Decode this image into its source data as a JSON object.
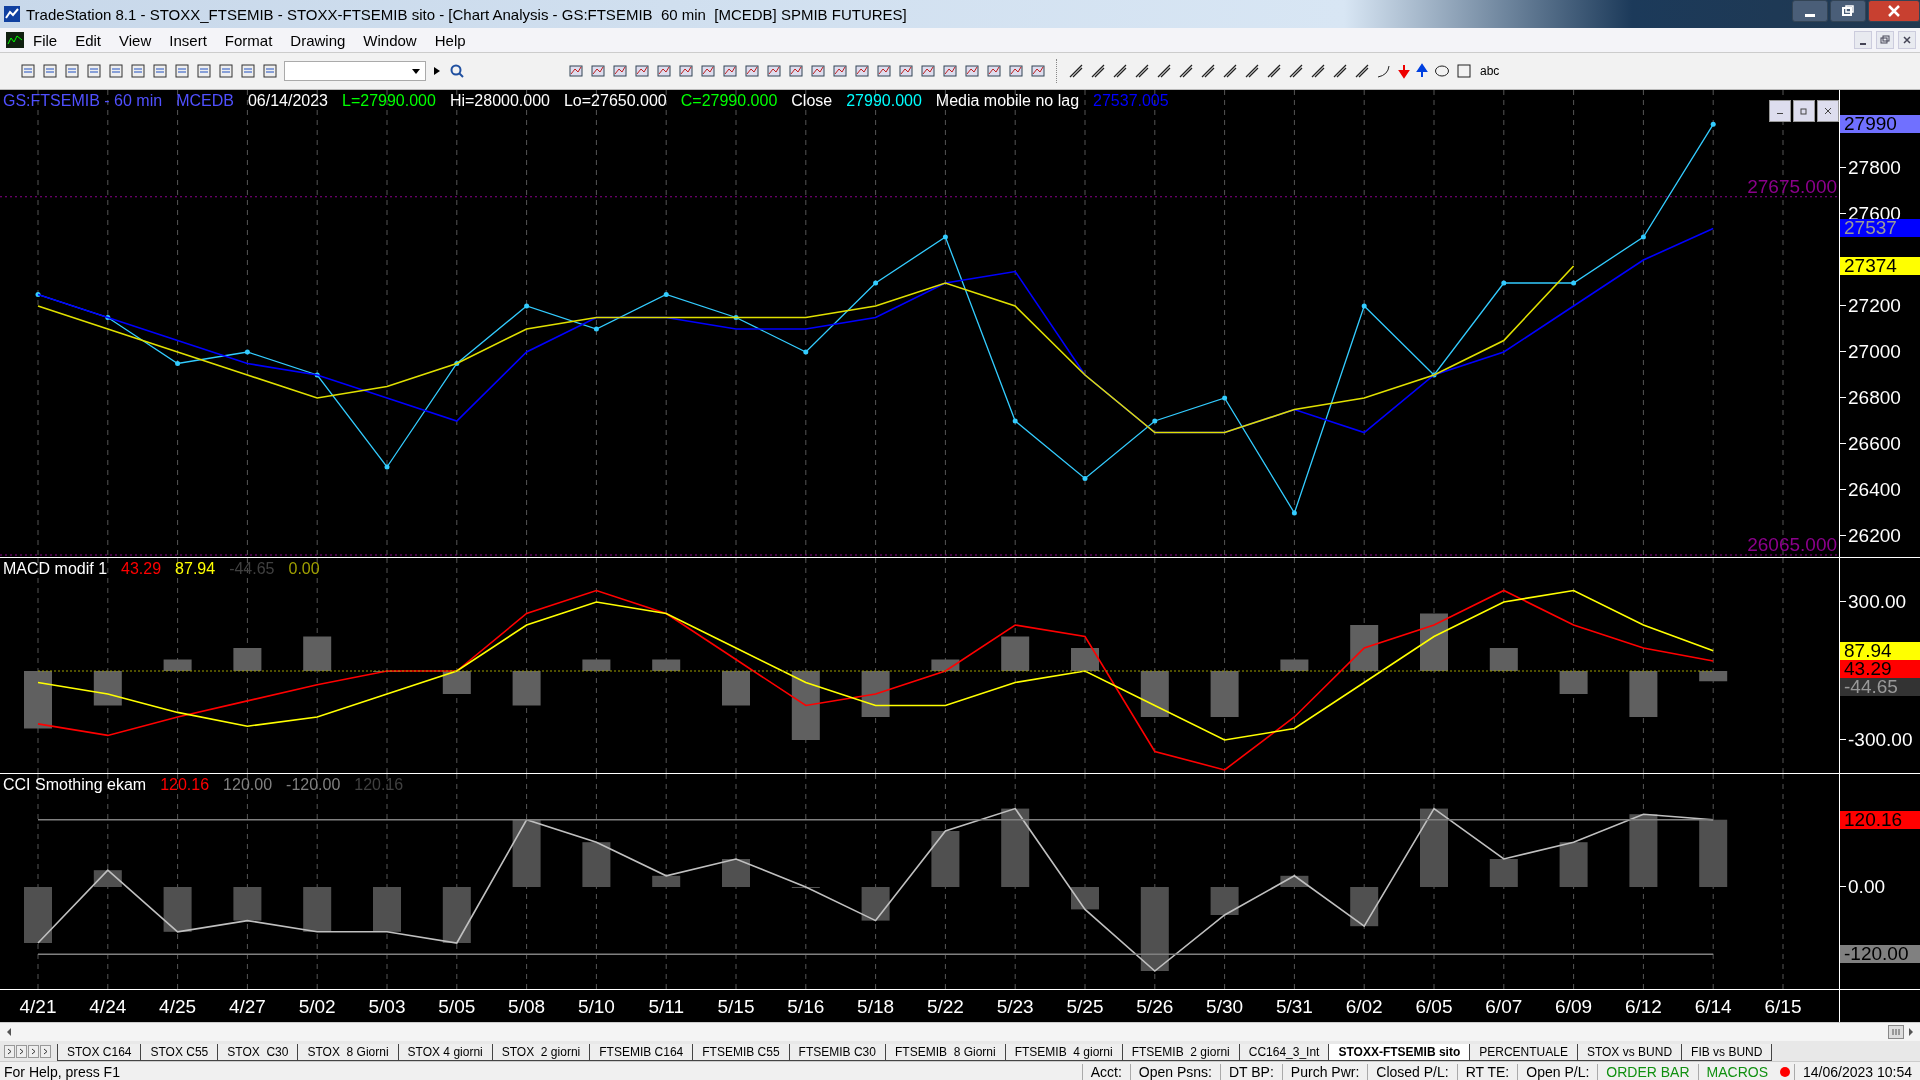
{
  "window": {
    "title": "TradeStation 8.1 - STOXX_FTSEMIB - STOXX-FTSEMIB sito - [Chart Analysis - GS:FTSEMIB  60 min  [MCEDB] SPMIB FUTURES]"
  },
  "menu": [
    "File",
    "Edit",
    "View",
    "Insert",
    "Format",
    "Drawing",
    "Window",
    "Help"
  ],
  "toolbar": {
    "text_tool": "abc"
  },
  "panes": [
    {
      "header": [
        {
          "text": "GS:FTSEMIB - 60 min",
          "color": "#5050ff"
        },
        {
          "text": "MCEDB",
          "color": "#5050ff"
        },
        {
          "text": "06/14/2023",
          "color": "#ffffff"
        },
        {
          "text": "L=27990.000",
          "color": "#00ff00"
        },
        {
          "text": "Hi=28000.000",
          "color": "#ffffff"
        },
        {
          "text": "Lo=27650.000",
          "color": "#ffffff"
        },
        {
          "text": "C=27990.000",
          "color": "#00ff00"
        },
        {
          "text": "Close",
          "color": "#ffffff"
        },
        {
          "text": "27990.000",
          "color": "#00ffff"
        },
        {
          "text": "Media mobile no lag",
          "color": "#ffffff"
        },
        {
          "text": "27537.005",
          "color": "#0000ff"
        }
      ],
      "y_labels": [
        "27800",
        "27600",
        "27200",
        "27000",
        "26800",
        "26600",
        "26400",
        "26200"
      ],
      "levels": [
        {
          "label": "27675.000",
          "color": "#8b008b"
        },
        {
          "label": "26065.000",
          "color": "#8b008b"
        }
      ],
      "badges": [
        {
          "label": "27990",
          "color": "#7070ff"
        },
        {
          "label": "27537",
          "color": "#0000ff"
        },
        {
          "label": "27374",
          "color": "#ffff00"
        }
      ]
    },
    {
      "header": [
        {
          "text": "MACD modif 1",
          "color": "#ffffff"
        },
        {
          "text": "43.29",
          "color": "#ff0000"
        },
        {
          "text": "87.94",
          "color": "#ffff00"
        },
        {
          "text": "-44.65",
          "color": "#404040"
        },
        {
          "text": "0.00",
          "color": "#a0a000"
        }
      ],
      "y_labels": [
        "300.00",
        "-300.00"
      ],
      "badges": [
        {
          "label": "87.94",
          "color": "#ffff00"
        },
        {
          "label": "43.29",
          "color": "#ff0000"
        },
        {
          "label": "-44.65",
          "color": "#333333"
        }
      ]
    },
    {
      "header": [
        {
          "text": "CCI Smothing ekam",
          "color": "#ffffff"
        },
        {
          "text": "120.16",
          "color": "#ff0000"
        },
        {
          "text": "120.00",
          "color": "#808080"
        },
        {
          "text": "-120.00",
          "color": "#808080"
        },
        {
          "text": "120.16",
          "color": "#404040"
        }
      ],
      "y_labels": [
        "0.00"
      ],
      "badges": [
        {
          "label": "120.16",
          "color": "#ff0000"
        },
        {
          "label": "-120.00",
          "color": "#808080"
        }
      ]
    }
  ],
  "time_axis": [
    "4/21",
    "4/24",
    "4/25",
    "4/27",
    "5/02",
    "5/03",
    "5/05",
    "5/08",
    "5/10",
    "5/11",
    "5/15",
    "5/16",
    "5/18",
    "5/22",
    "5/23",
    "5/25",
    "5/26",
    "5/30",
    "5/31",
    "6/02",
    "6/05",
    "6/07",
    "6/09",
    "6/12",
    "6/14",
    "6/15"
  ],
  "sheet_tabs": [
    {
      "label": "STOX C164",
      "selected": false
    },
    {
      "label": "STOX C55",
      "selected": false
    },
    {
      "label": "STOX  C30",
      "selected": false
    },
    {
      "label": "STOX  8 Giorni",
      "selected": false
    },
    {
      "label": "STOX 4 giorni",
      "selected": false
    },
    {
      "label": "STOX  2 giorni",
      "selected": false
    },
    {
      "label": "FTSEMIB C164",
      "selected": false
    },
    {
      "label": "FTSEMIB C55",
      "selected": false
    },
    {
      "label": "FTSEMIB C30",
      "selected": false
    },
    {
      "label": "FTSEMIB  8 Giorni",
      "selected": false
    },
    {
      "label": "FTSEMIB  4 giorni",
      "selected": false
    },
    {
      "label": "FTSEMIB  2 giorni",
      "selected": false
    },
    {
      "label": "CC164_3_Int",
      "selected": false
    },
    {
      "label": "STOXX-FTSEMIB sito",
      "selected": true
    },
    {
      "label": "PERCENTUALE",
      "selected": false
    },
    {
      "label": "STOX vs BUND",
      "selected": false
    },
    {
      "label": "FIB vs BUND",
      "selected": false
    }
  ],
  "status_bar": {
    "help": "For Help, press F1",
    "fields": [
      {
        "text": "Acct:",
        "color": "#000000"
      },
      {
        "text": "Open Psns:",
        "color": "#000000"
      },
      {
        "text": "DT BP:",
        "color": "#000000"
      },
      {
        "text": "Purch Pwr:",
        "color": "#000000"
      },
      {
        "text": "Closed P/L:",
        "color": "#000000"
      },
      {
        "text": "RT TE:",
        "color": "#000000"
      },
      {
        "text": "Open P/L:",
        "color": "#000000"
      },
      {
        "text": "ORDER BAR",
        "color": "#109010"
      },
      {
        "text": "MACROS",
        "color": "#109010"
      }
    ],
    "connection": {
      "color": "#ff0000"
    },
    "datetime": "14/06/2023 10:54"
  }
}
